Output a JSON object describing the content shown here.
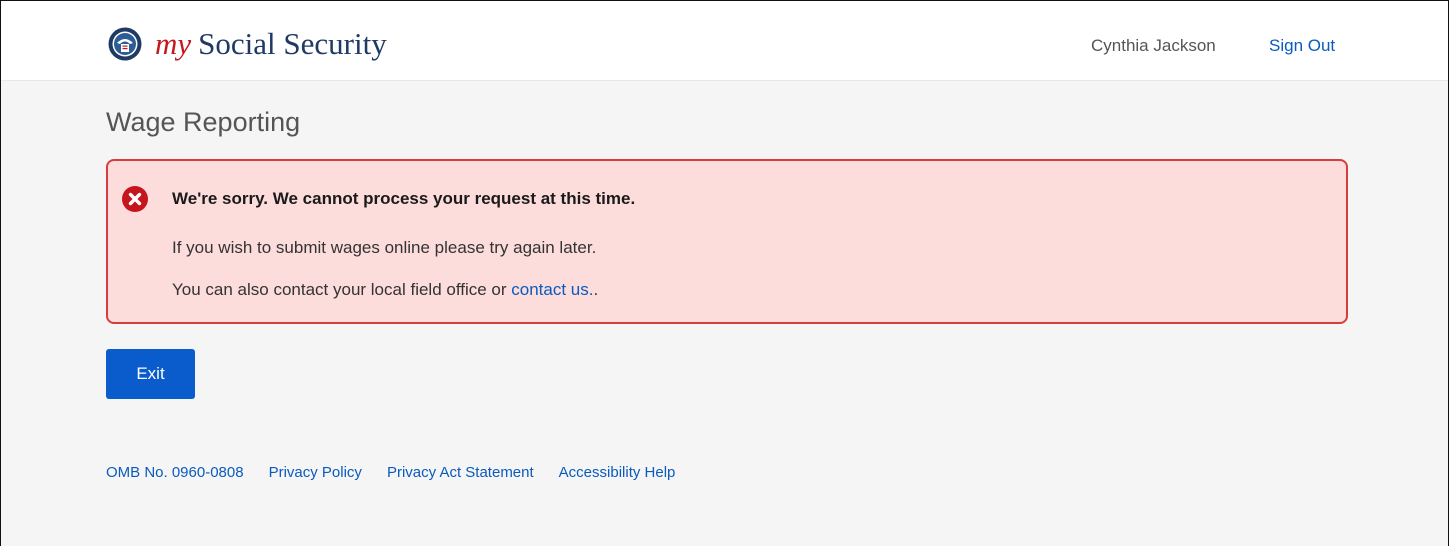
{
  "header": {
    "brand_prefix": "my",
    "brand_name": "Social Security",
    "user_name": "Cynthia Jackson",
    "sign_out_label": "Sign Out"
  },
  "page": {
    "title": "Wage Reporting"
  },
  "alert": {
    "icon": "error-circle-x-icon",
    "heading": "We're sorry. We cannot process your request at this time.",
    "line1": "If you wish to submit wages online please try again later.",
    "line2_prefix": "You can also contact your local field office or ",
    "line2_link": "contact us.",
    "line2_suffix": "."
  },
  "actions": {
    "exit_label": "Exit"
  },
  "footer": {
    "links": [
      "OMB No. 0960-0808",
      "Privacy Policy",
      "Privacy Act Statement",
      "Accessibility Help"
    ]
  },
  "colors": {
    "brand_red": "#c4161c",
    "brand_navy": "#1f3a63",
    "link_blue": "#0a5bbd",
    "button_blue": "#0a5bcc",
    "alert_bg": "#fddcdc",
    "alert_border": "#d83d3d",
    "page_bg": "#f5f5f5"
  }
}
